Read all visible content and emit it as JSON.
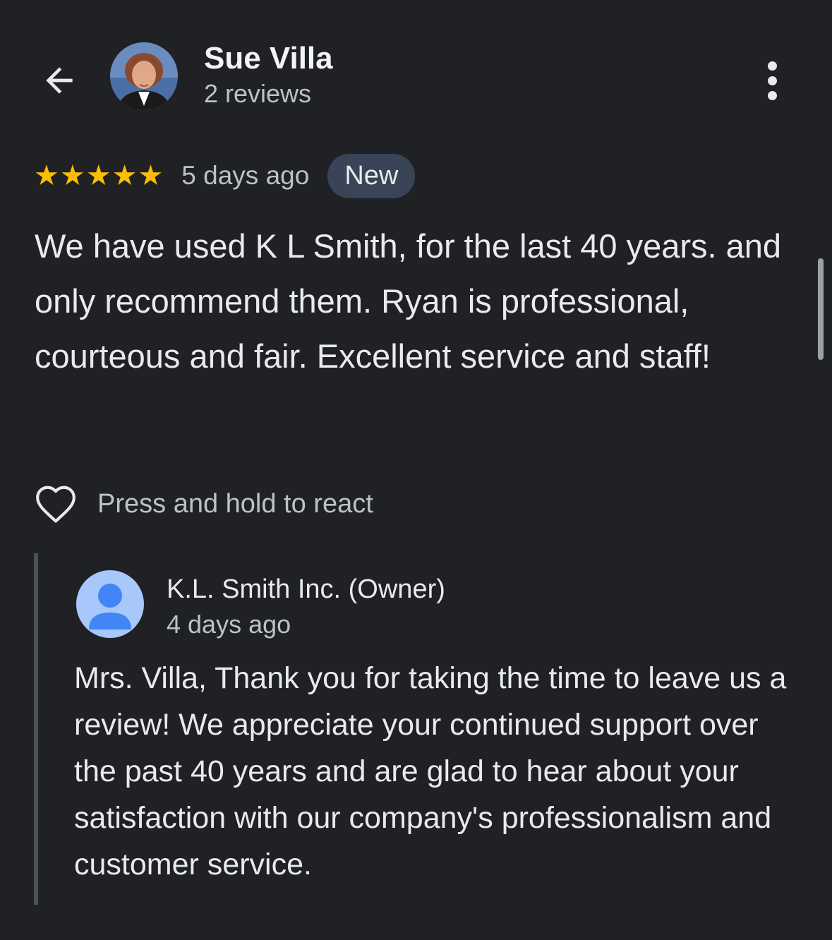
{
  "reviewer": {
    "name": "Sue Villa",
    "review_count": "2 reviews"
  },
  "review": {
    "rating": 5,
    "stars": [
      "★",
      "★",
      "★",
      "★",
      "★"
    ],
    "date": "5 days ago",
    "badge": "New",
    "text": "We have used K L Smith, for the last 40 years. and only recommend them. Ryan is professional, courteous and fair. Excellent service and staff!"
  },
  "reaction": {
    "label": "Press and hold to react"
  },
  "owner_reply": {
    "name": "K.L. Smith Inc. (Owner)",
    "date": "4 days ago",
    "text": "Mrs. Villa, Thank you for taking the time to leave us a review! We appreciate your continued support over the past 40 years and are glad to hear about your satisfaction with our company's professionalism and customer service."
  },
  "icons": {
    "back": "arrow-back-icon",
    "more": "more-vert-icon",
    "star": "star-icon",
    "react": "heart-outline-icon",
    "owner_avatar": "person-icon"
  },
  "colors": {
    "background": "#202124",
    "star": "#fbbc04",
    "badge_bg": "#394457",
    "reply_border": "#4d5156",
    "owner_avatar_bg": "#a8c7fa",
    "owner_avatar_fg": "#4285f4"
  }
}
